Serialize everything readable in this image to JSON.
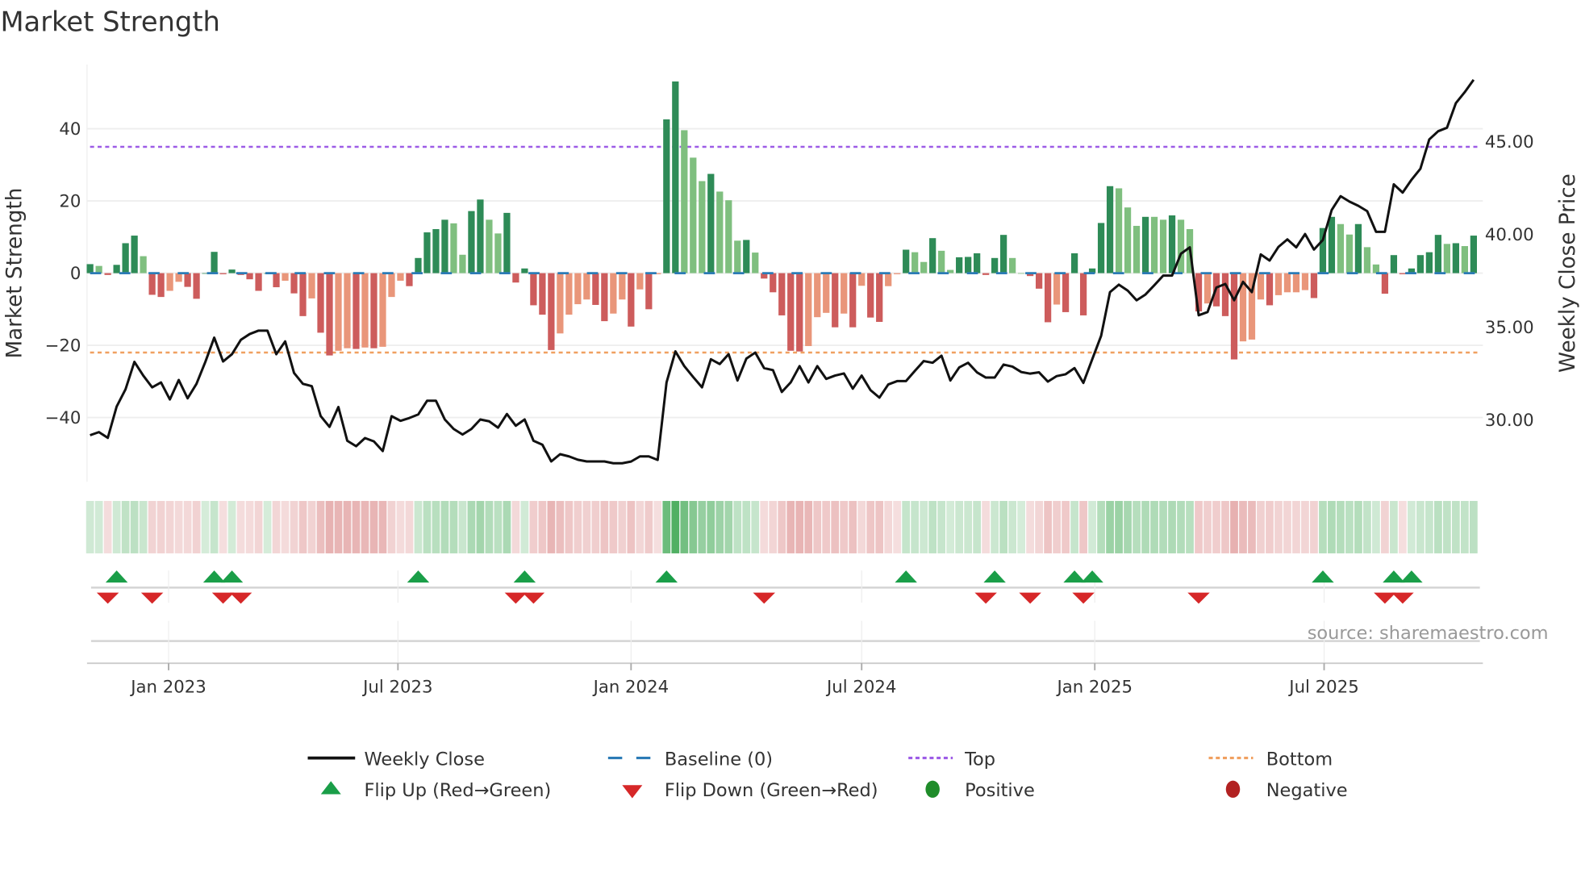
{
  "chart_data": {
    "type": "bar",
    "title": "Market Strength",
    "ylabel": "Market Strength",
    "y2label": "Weekly Close Price",
    "ylim": [
      -57.8,
      57.8
    ],
    "y2lim": [
      26.6,
      49.1
    ],
    "yticks": [
      40,
      20,
      0,
      -20,
      -40
    ],
    "ytick_labels": [
      "40",
      "20",
      "0",
      "−20",
      "−40"
    ],
    "y2ticks": [
      45,
      40,
      35,
      30
    ],
    "y2tick_labels": [
      "45.00",
      "40.00",
      "35.00",
      "30.00"
    ],
    "x_start": "2022-10-31",
    "x_step_days": 7,
    "xticks": [
      "2023-01-01",
      "2023-07-01",
      "2024-01-01",
      "2024-07-01",
      "2025-01-01",
      "2025-07-01"
    ],
    "xtick_labels": [
      "Jan 2023",
      "Jul 2023",
      "Jan 2024",
      "Jul 2024",
      "Jan 2025",
      "Jul 2025"
    ],
    "grid": true,
    "top_level": 35,
    "bottom_level": -22,
    "baseline": 0,
    "strength": [
      2.5,
      2,
      -0.5,
      2.3,
      8.3,
      10.4,
      4.7,
      -6,
      -6.6,
      -4.9,
      -2.4,
      -3.8,
      -7.1,
      0,
      5.9,
      -0.3,
      1,
      -0.5,
      -1.7,
      -4.9,
      0,
      -3.9,
      -2.1,
      -5.6,
      -11.9,
      -7,
      -16.5,
      -22.8,
      -21.5,
      -20.8,
      -21,
      -20.6,
      -20.8,
      -20.4,
      -6.6,
      -2.1,
      -3.6,
      4.2,
      11.3,
      12.2,
      14.8,
      13.8,
      5.1,
      17.2,
      20.4,
      14.8,
      11,
      16.7,
      -2.6,
      1.3,
      -8.9,
      -11.5,
      -21.3,
      -16.7,
      -11.5,
      -8.6,
      -7.3,
      -8.8,
      -13.3,
      -11.2,
      -7.3,
      -14.8,
      -4.5,
      -10,
      -0.3,
      42.6,
      53.1,
      39.6,
      32,
      25.5,
      27.5,
      22.6,
      20.2,
      9,
      9.2,
      5.7,
      -1.5,
      -5.3,
      -11.7,
      -21.5,
      -21.7,
      -20.2,
      -12.2,
      -11,
      -15,
      -11.2,
      -15,
      -3.5,
      -12.3,
      -13.5,
      -3.6,
      -0.3,
      6.5,
      5.8,
      3.1,
      9.7,
      6.2,
      0.9,
      4.4,
      4.5,
      5.5,
      -0.5,
      4.2,
      10.6,
      4.2,
      0,
      -0.8,
      -4.3,
      -13.6,
      -8.7,
      -10.8,
      5.5,
      -11.7,
      1.3,
      13.9,
      24.1,
      23.5,
      18.2,
      13.1,
      15.6,
      15.6,
      14.8,
      16,
      14.8,
      12.2,
      -10.6,
      -8.4,
      -9.2,
      -11.9,
      -23.9,
      -18.9,
      -18.4,
      -7.3,
      -8.9,
      -6.1,
      -5.3,
      -5.3,
      -4.7,
      -6.9,
      12.5,
      15.6,
      13.6,
      10.7,
      13.6,
      7.2,
      2.4,
      -5.7,
      5,
      -0.3,
      1.3,
      5,
      5.8,
      10.6,
      8.1,
      8.3,
      7.5,
      10.4
    ],
    "weekly_close": [
      29.11,
      29.28,
      28.97,
      30.66,
      31.59,
      33.07,
      32.33,
      31.69,
      31.96,
      31.04,
      32.09,
      31.1,
      31.88,
      33.07,
      34.37,
      33.09,
      33.48,
      34.25,
      34.57,
      34.75,
      34.75,
      33.48,
      34.17,
      32.47,
      31.88,
      31.76,
      30.15,
      29.56,
      30.63,
      28.81,
      28.52,
      28.96,
      28.78,
      28.26,
      30.14,
      29.89,
      30.04,
      30.23,
      30.97,
      30.97,
      29.96,
      29.45,
      29.15,
      29.45,
      29.96,
      29.86,
      29.52,
      30.26,
      29.62,
      29.96,
      28.81,
      28.6,
      27.7,
      28.09,
      27.97,
      27.79,
      27.7,
      27.7,
      27.7,
      27.6,
      27.6,
      27.69,
      27.97,
      27.97,
      27.78,
      31.96,
      33.63,
      32.84,
      32.25,
      31.69,
      33.21,
      32.95,
      33.48,
      32.06,
      33.24,
      33.57,
      32.73,
      32.62,
      31.44,
      31.96,
      32.84,
      31.96,
      32.84,
      32.15,
      32.33,
      32.44,
      31.62,
      32.33,
      31.54,
      31.14,
      31.85,
      32.03,
      32.03,
      32.58,
      33.11,
      33.02,
      33.4,
      32.06,
      32.77,
      33.02,
      32.5,
      32.22,
      32.22,
      32.92,
      32.81,
      32.52,
      32.43,
      32.5,
      32.0,
      32.3,
      32.4,
      32.73,
      31.93,
      33.21,
      34.47,
      36.83,
      37.23,
      36.91,
      36.39,
      36.7,
      37.2,
      37.72,
      37.72,
      38.9,
      39.24,
      35.58,
      35.75,
      37.08,
      37.27,
      36.39,
      37.38,
      36.83,
      38.86,
      38.53,
      39.27,
      39.67,
      39.24,
      39.96,
      39.12,
      39.64,
      41.26,
      42.0,
      41.71,
      41.48,
      41.19,
      40.08,
      40.08,
      42.64,
      42.19,
      42.89,
      43.48,
      45.06,
      45.5,
      45.69,
      47.02,
      47.61,
      48.28
    ],
    "flip_up_weeks": [
      3,
      14,
      16,
      37,
      49,
      65,
      92,
      102,
      111,
      113,
      139,
      147,
      149
    ],
    "flip_down_weeks": [
      2,
      7,
      15,
      17,
      48,
      50,
      76,
      101,
      106,
      112,
      125,
      146,
      148
    ],
    "legend": {
      "placement": "bottom",
      "items": [
        "Weekly Close",
        "Baseline (0)",
        "Top",
        "Bottom",
        "Flip Up (Red→Green)",
        "Flip Down (Green→Red)",
        "Positive",
        "Negative"
      ]
    },
    "colors": {
      "pos_strong": "#2e8b57",
      "pos_weak": "#7fbf7f",
      "neg_strong": "#cd5c5c",
      "neg_weak": "#e9967a",
      "line": "#111111",
      "baseline": "#2c7bb6",
      "top": "#9d5ce6",
      "bottom": "#f0a060",
      "flip_up": "#1a9e48",
      "flip_down": "#d62728",
      "positive": "#1f8c2a",
      "negative": "#b22222",
      "strip_pos": "46,160,67",
      "strip_neg": "205,92,92"
    }
  },
  "source": "source: sharemaestro.com"
}
